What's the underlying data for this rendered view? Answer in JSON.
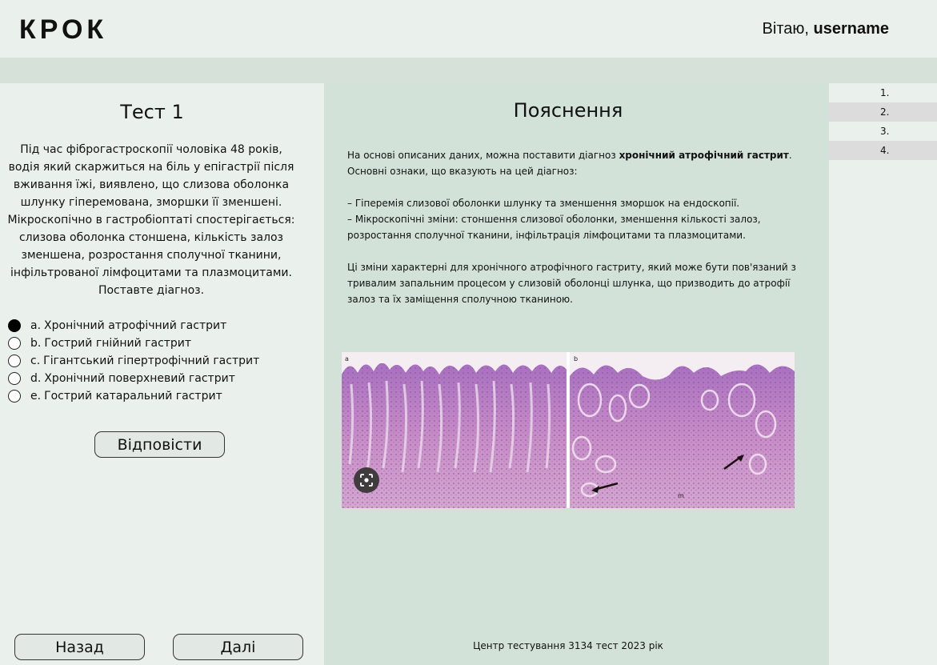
{
  "header": {
    "logo": "КРОК",
    "greeting_prefix": "Вітаю, ",
    "username": "username"
  },
  "test": {
    "title": "Тест 1",
    "question": "Під час фіброгастроскопії чоловіка 48 років, водія який скаржиться на біль у епігастрії після вживання їжі, виявлено, що слизова оболонка шлунку гіперемована, зморшки її зменшені. Мікроскопічно в гастробіоптаті спостерігається: слизова оболонка стоншена, кількість залоз зменшена, розростання сполучної тканини, інфільтрованої лімфоцитами та плазмоцитами. Поставте діагноз.",
    "options": [
      {
        "key": "a.",
        "text": "Хронічний атрофічний гастрит",
        "selected": true
      },
      {
        "key": "b.",
        "text": "Гострий гнійний гастрит",
        "selected": false
      },
      {
        "key": "c.",
        "text": "Гігантський гіпертрофічний гастрит",
        "selected": false
      },
      {
        "key": "d.",
        "text": "Хронічний поверхневий гастрит",
        "selected": false
      },
      {
        "key": "e.",
        "text": "Гострий катаральний гастрит",
        "selected": false
      }
    ],
    "answer_label": "Відповісти",
    "back_label": "Назад",
    "next_label": "Далі"
  },
  "explanation": {
    "title": "Пояснення",
    "intro_before": "На основі описаних даних, можна поставити діагноз ",
    "diagnosis": "хронічний атрофічний гастрит",
    "intro_after": ".",
    "line2": "Основні ознаки, що вказують на цей діагноз:",
    "bullet1": "– Гіперемія слизової оболонки шлунку та зменшення зморшок на ендоскопії.",
    "bullet2": "– Мікроскопічні зміни: стоншення слизової оболонки, зменшення кількості залоз, розростання сполучної тканини, інфільтрація лімфоцитами та плазмоцитами.",
    "conclusion": "Ці зміни характерні для хронічного атрофічного гастриту, який може бути пов'язаний з тривалим запальним процесом у слизовій оболонці шлунка, що призводить до атрофії залоз та їх заміщення сполучною тканиною.",
    "image_label_a": "a",
    "image_label_b": "b",
    "image_label_m": "m",
    "footer": "Центр тестування 3134 тест 2023 рік"
  },
  "question_nav": [
    "1.",
    "2.",
    "3.",
    "4."
  ],
  "colors": {
    "page_bg": "#dce6df",
    "panel_bg": "#eaf0ec",
    "explanation_bg": "#d2e2d8",
    "tissue_pink": "#c98bc2",
    "tissue_purple": "#8a5fb0"
  },
  "icons": {
    "scan": "lens-scan-icon"
  }
}
